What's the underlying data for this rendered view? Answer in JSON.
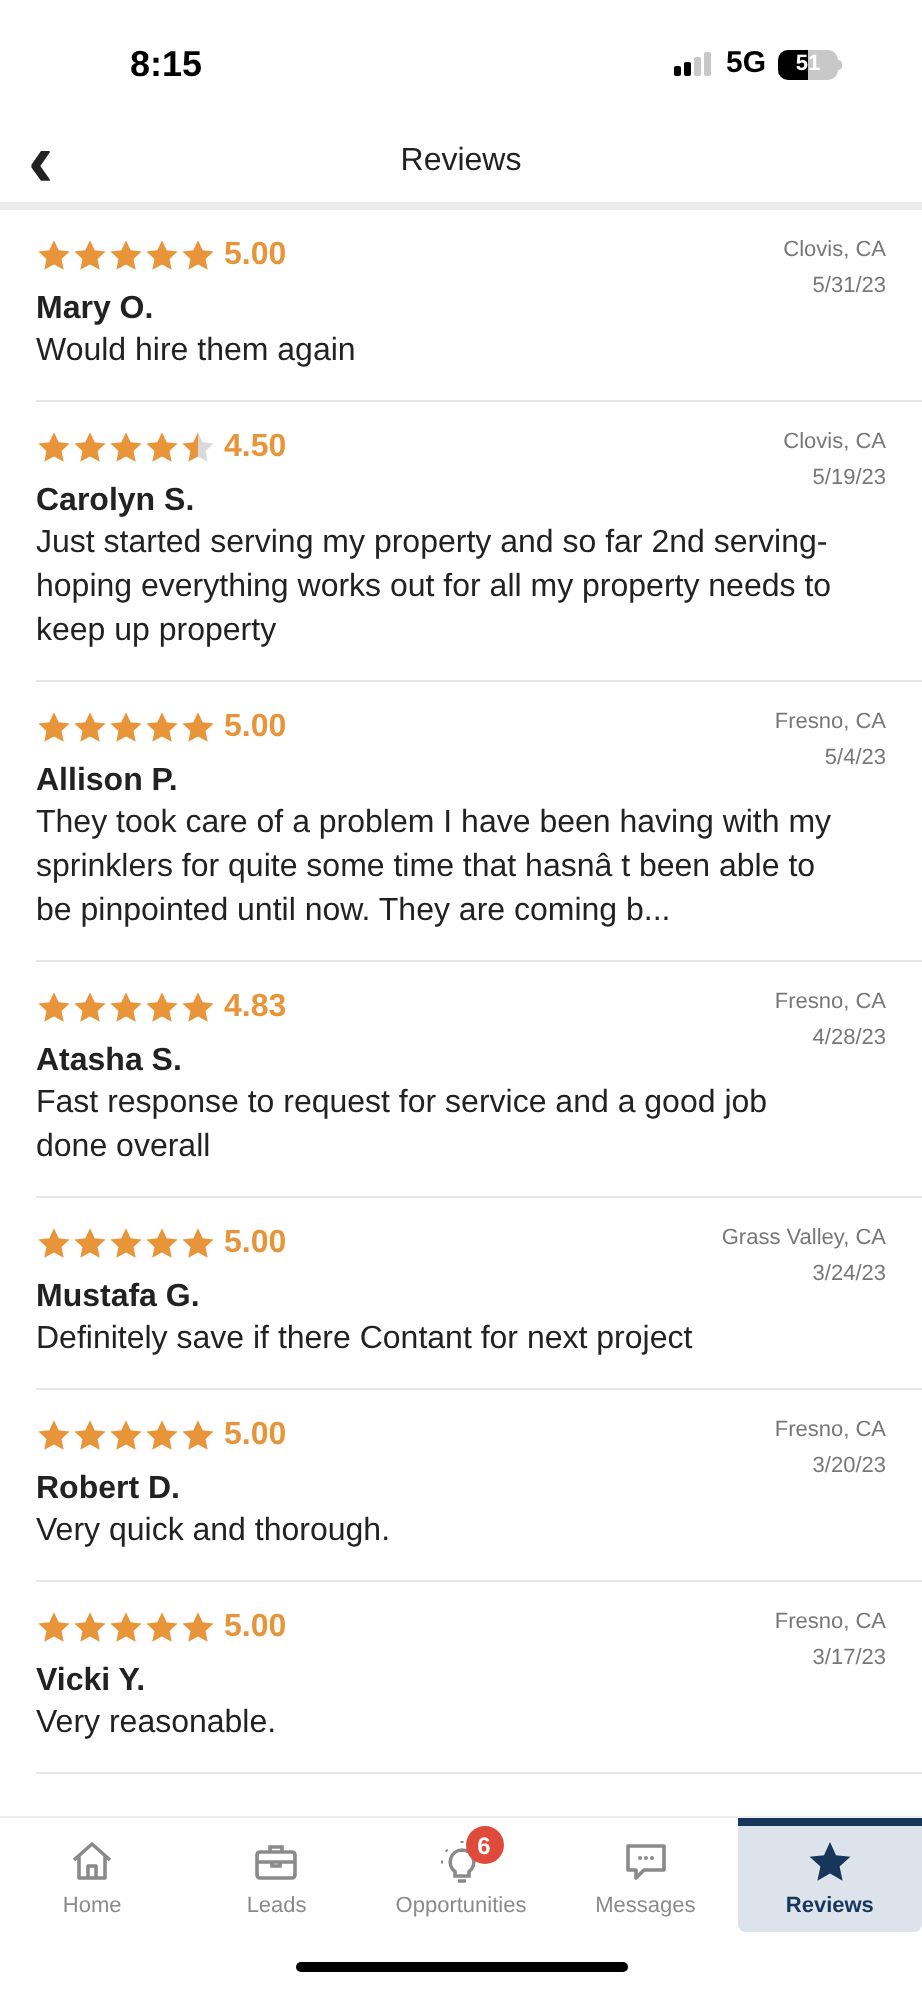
{
  "status_bar": {
    "time": "8:15",
    "network": "5G",
    "battery": "51"
  },
  "header": {
    "title": "Reviews",
    "back": "‹"
  },
  "reviews": [
    {
      "stars": 5,
      "rating": "5.00",
      "location": "Clovis, CA",
      "date": "5/31/23",
      "name": "Mary O.",
      "text": "Would hire them again"
    },
    {
      "stars": 4.5,
      "rating": "4.50",
      "location": "Clovis, CA",
      "date": "5/19/23",
      "name": "Carolyn S.",
      "text": "Just started serving my property and so far 2nd serving- hoping everything works out for all my property needs to keep up property"
    },
    {
      "stars": 5,
      "rating": "5.00",
      "location": "Fresno, CA",
      "date": "5/4/23",
      "name": "Allison P.",
      "text": "They took care of a problem I have been having with my sprinklers for quite some time that hasnâ t been able to be pinpointed until now. They are coming b..."
    },
    {
      "stars": 5,
      "rating": "4.83",
      "location": "Fresno, CA",
      "date": "4/28/23",
      "name": "Atasha S.",
      "text": "Fast response to request for service and a good job done overall"
    },
    {
      "stars": 5,
      "rating": "5.00",
      "location": "Grass Valley, CA",
      "date": "3/24/23",
      "name": "Mustafa G.",
      "text": "Definitely save if there Contant for next project"
    },
    {
      "stars": 5,
      "rating": "5.00",
      "location": "Fresno, CA",
      "date": "3/20/23",
      "name": "Robert D.",
      "text": "Very quick and thorough."
    },
    {
      "stars": 5,
      "rating": "5.00",
      "location": "Fresno, CA",
      "date": "3/17/23",
      "name": "Vicki Y.",
      "text": "Very reasonable."
    }
  ],
  "tabs": [
    {
      "label": "Home",
      "selected": false
    },
    {
      "label": "Leads",
      "selected": false
    },
    {
      "label": "Opportunities",
      "selected": false,
      "badge": "6"
    },
    {
      "label": "Messages",
      "selected": false
    },
    {
      "label": "Reviews",
      "selected": true
    }
  ]
}
